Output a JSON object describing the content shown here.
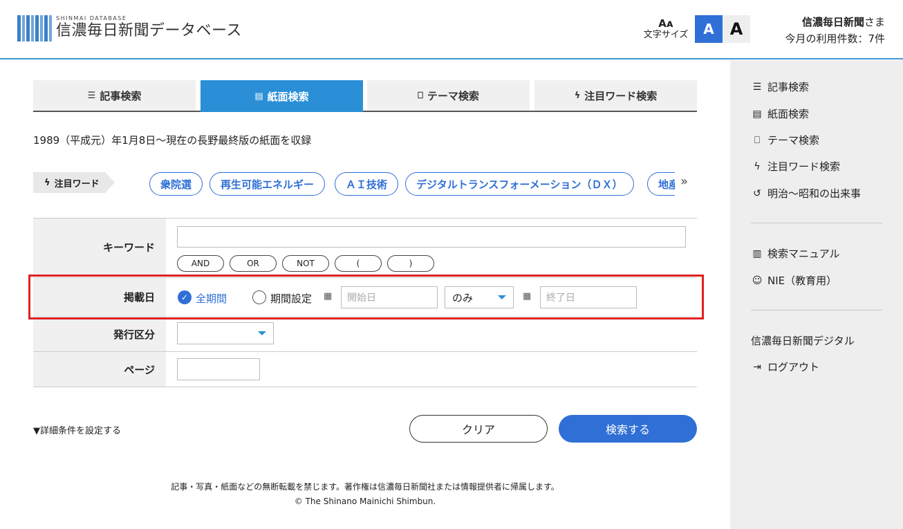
{
  "header": {
    "logo_sub": "SHINMAI DATABASE",
    "logo_title": "信濃毎日新聞データベース",
    "font_size_icon": "Aᴀ",
    "font_size_label": "文字サイズ",
    "font_small": "A",
    "font_large": "A",
    "user_name": "信濃毎日新聞",
    "user_suffix": "さま",
    "usage": "今月の利用件数：7件"
  },
  "tabs": [
    {
      "label": "記事検索",
      "icon": "list-icon"
    },
    {
      "label": "紙面検索",
      "icon": "newspaper-icon"
    },
    {
      "label": "テーマ検索",
      "icon": "bookmark-icon"
    },
    {
      "label": "注目ワード検索",
      "icon": "bolt-icon"
    }
  ],
  "intro": "1989（平成元）年1月8日〜現在の長野最終版の紙面を収録",
  "keywords": {
    "label": "注目ワード",
    "chips": [
      "衆院選",
      "再生可能エネルギー",
      "ＡＩ技術",
      "デジタルトランスフォーメーション（ＤＸ）",
      "地産地消"
    ],
    "more": "»"
  },
  "form": {
    "keyword_label": "キーワード",
    "keyword_value": "",
    "operators": [
      "AND",
      "OR",
      "NOT",
      "(",
      ")"
    ],
    "date_label": "掲載日",
    "all_period": "全期間",
    "set_period": "期間設定",
    "start_placeholder": "開始日",
    "range_option": "のみ",
    "end_placeholder": "終了日",
    "issue_label": "発行区分",
    "issue_value": "",
    "page_label": "ページ",
    "page_value": ""
  },
  "actions": {
    "detail_toggle": "▼詳細条件を設定する",
    "clear": "クリア",
    "search": "検索する"
  },
  "sidebar": {
    "group1": [
      {
        "label": "記事検索",
        "icon": "list-icon"
      },
      {
        "label": "紙面検索",
        "icon": "newspaper-icon"
      },
      {
        "label": "テーマ検索",
        "icon": "bookmark-icon"
      },
      {
        "label": "注目ワード検索",
        "icon": "bolt-icon"
      },
      {
        "label": "明治〜昭和の出来事",
        "icon": "history-icon"
      }
    ],
    "group2": [
      {
        "label": "検索マニュアル",
        "icon": "book-icon"
      },
      {
        "label": "NIE（教育用）",
        "icon": "student-icon"
      }
    ],
    "group3": [
      {
        "label": "信濃毎日新聞デジタル"
      },
      {
        "label": "ログアウト",
        "icon": "logout-icon"
      }
    ]
  },
  "footer": {
    "notice": "記事・写真・紙面などの無断転載を禁じます。著作権は信濃毎日新聞社または情報提供者に帰属します。",
    "copyright": "© The Shinano Mainichi Shimbun."
  },
  "colors": {
    "accent": "#2f6fd6",
    "tab_active": "#2a8fd6",
    "highlight": "#e02020"
  }
}
